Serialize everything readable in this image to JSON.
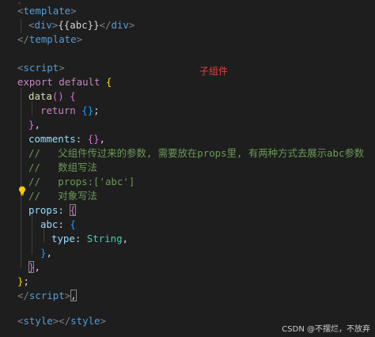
{
  "annotation": "子组件",
  "watermark": "CSDN @不摆烂，不放弃",
  "code": {
    "template_open": "template",
    "div_open": "div",
    "div_expr": "{{abc}}",
    "div_close": "div",
    "template_close": "template",
    "script_open": "script",
    "export_kw": "export",
    "default_kw": "default",
    "data_fn": "data",
    "return_kw": "return",
    "comments_key": "comments",
    "comment_1": "//   父组件传过来的参数, 需要放在props里, 有两种方式去展示abc参数",
    "comment_2": "//   数组写法",
    "comment_3": "//   props:['abc']",
    "comment_4": "//   对象写法",
    "props_key": "props",
    "abc_key": "abc",
    "type_key": "type",
    "string_type": "String",
    "script_close": "script",
    "style_open": "style",
    "style_close": "style"
  }
}
